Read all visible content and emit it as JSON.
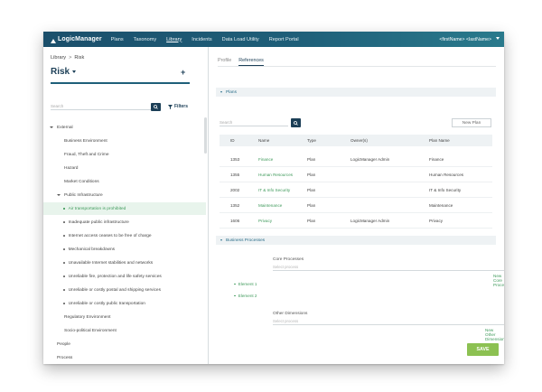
{
  "app": {
    "logo": "LogicManager",
    "nav": [
      "Plans",
      "Taxonomy",
      "Library",
      "Incidents",
      "Data Load Utility",
      "Report Portal"
    ],
    "active_nav": "Library",
    "user": "<firstName> <lastName>"
  },
  "left": {
    "breadcrumb": [
      "Library",
      "Risk"
    ],
    "title": "Risk",
    "add_symbol": "+",
    "search_placeholder": "Search",
    "filters_label": "Filters",
    "tree": [
      {
        "label": "External",
        "level": 0,
        "toggle": "down"
      },
      {
        "label": "Business Environment",
        "level": 1,
        "toggle": "right"
      },
      {
        "label": "Fraud, Theft and Crime",
        "level": 1,
        "toggle": "right"
      },
      {
        "label": "Hazard",
        "level": 1,
        "toggle": "right"
      },
      {
        "label": "Market Conditions",
        "level": 1,
        "toggle": "right"
      },
      {
        "label": "Public Infrastructure",
        "level": 1,
        "toggle": "down"
      },
      {
        "label": "Air transportation is prohibited",
        "level": 2,
        "toggle": "dot",
        "selected": true
      },
      {
        "label": "Inadequate public infrastructure",
        "level": 2,
        "toggle": "dot"
      },
      {
        "label": "Internet access ceases to be free of charge",
        "level": 2,
        "toggle": "dot"
      },
      {
        "label": "Mechanical breakdowns",
        "level": 2,
        "toggle": "dot"
      },
      {
        "label": "Unavailable Internet stabilities and networks",
        "level": 2,
        "toggle": "dot"
      },
      {
        "label": "Unreliable fire, protection and life safety services",
        "level": 2,
        "toggle": "dot"
      },
      {
        "label": "Unreliable or costly postal and shipping services",
        "level": 2,
        "toggle": "dot"
      },
      {
        "label": "Unreliable or costly public transportation",
        "level": 2,
        "toggle": "dot"
      },
      {
        "label": "Regulatory Environment",
        "level": 1,
        "toggle": "right"
      },
      {
        "label": "Socio-political Environment",
        "level": 1,
        "toggle": "right"
      },
      {
        "label": "People",
        "level": 0,
        "toggle": "right"
      },
      {
        "label": "Process",
        "level": 0,
        "toggle": "right"
      }
    ]
  },
  "right": {
    "tabs": [
      "Profile",
      "References"
    ],
    "active_tab": "References",
    "plans_section": "Plans",
    "search_placeholder": "Search",
    "new_plan_label": "New Plan",
    "columns": [
      "ID",
      "Name",
      "Type",
      "Owner(s)",
      "Plan Name"
    ],
    "rows": [
      {
        "id": "1353",
        "name": "Finance",
        "type": "Plan",
        "owner": "LogicManager Admin",
        "plan": "Finance"
      },
      {
        "id": "1355",
        "name": "Human Resources",
        "type": "Plan",
        "owner": "",
        "plan": "Human Resources"
      },
      {
        "id": "2002",
        "name": "IT & Info Security",
        "type": "Plan",
        "owner": "",
        "plan": "IT & Info Security"
      },
      {
        "id": "1352",
        "name": "Maintenance",
        "type": "Plan",
        "owner": "",
        "plan": "Maintenance"
      },
      {
        "id": "1606",
        "name": "Privacy",
        "type": "Plan",
        "owner": "LogicManager Admin",
        "plan": "Privacy"
      }
    ],
    "bp_section": "Business Processes",
    "core_label": "Core Processes",
    "core_placeholder": "Select process",
    "new_core_link": "New Core Process",
    "elements": [
      "Element 1",
      "Element 2"
    ],
    "other_label": "Other Dimensions",
    "other_placeholder": "Select process",
    "new_other_link": "New Other Dimension",
    "save_label": "SAVE"
  },
  "colors": {
    "nav_bg": "#1f5f79",
    "accent_green": "#3f9a5b",
    "save_green": "#8cc152",
    "dark_blue": "#1c3f57"
  }
}
